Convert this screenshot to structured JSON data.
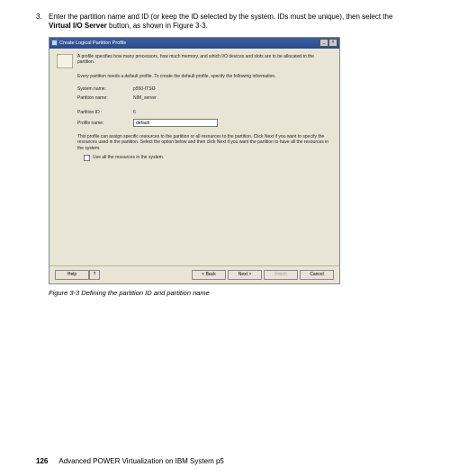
{
  "instruction": {
    "number": "3.",
    "text_before_bold": "Enter the partition name and ID (or keep the ID selected by the system. IDs must be unique), then select the ",
    "bold": "Virtual I/O Server",
    "text_after_bold": " button, as shown in Figure 3-3."
  },
  "window": {
    "title": "Create Logical Partition Profile",
    "minimize": "_",
    "close": "×",
    "intro": "A profile specifies how many processors, how much memory, and which I/O devices and slots are to be allocated to the partition.",
    "sub": "Every partition needs a default profile. To create the default profile, specify the following information.",
    "fields": {
      "system_label": "System name:",
      "system_value": "p550-ITSO",
      "partition_label": "Partition name:",
      "partition_value": "NIM_server",
      "partid_label": "Partition ID :",
      "partid_value": "6",
      "profile_label": "Profile name:",
      "profile_value": "default"
    },
    "profile_note": "This profile can assign specific resources to the partition or all resources to the partition. Click Next if you want to specify the resources used in the partition. Select the option below and then click Next if you want the partition to have all the resources in the system.",
    "checkbox_label": "Use all the resources in the system.",
    "buttons": {
      "help": "Help",
      "help_arrow": "?",
      "back": "< Back",
      "next": "Next >",
      "finish": "Finish",
      "cancel": "Cancel"
    }
  },
  "caption": "Figure 3-3   Defining the partition ID and partition name",
  "footer": {
    "page": "126",
    "book": "Advanced POWER Virtualization on IBM System p5"
  }
}
